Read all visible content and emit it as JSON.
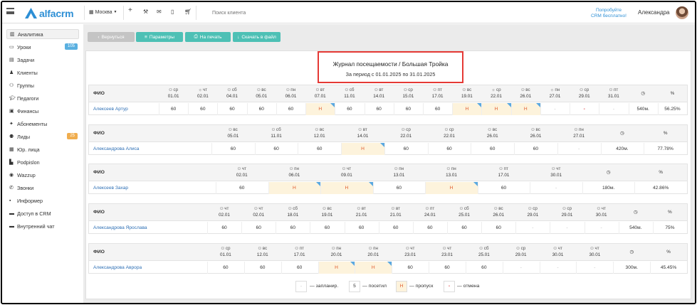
{
  "app": {
    "logo": "alfacrm",
    "city": "Москва",
    "search_placeholder": "Поиск клиента",
    "promo_line1": "Попробуйте",
    "promo_line2": "CRM бесплатно!",
    "user": "Александра",
    "accent": "#2d8fd5"
  },
  "toolbar_icons": [
    "plus-icon",
    "wrench-icon",
    "mail-icon",
    "phone-icon",
    "cart-icon"
  ],
  "sidebar": [
    {
      "label": "Аналитика",
      "icon": "chart-icon",
      "active": true
    },
    {
      "label": "Уроки",
      "icon": "calendar-icon",
      "badge": "105",
      "badge_color": "#5ab0e0"
    },
    {
      "label": "Задачи",
      "icon": "tasks-icon"
    },
    {
      "label": "Клиенты",
      "icon": "user-icon"
    },
    {
      "label": "Группы",
      "icon": "group-icon"
    },
    {
      "label": "Педагоги",
      "icon": "graduation-icon"
    },
    {
      "label": "Финансы",
      "icon": "money-icon"
    },
    {
      "label": "Абонементы",
      "icon": "ticket-icon"
    },
    {
      "label": "Лиды",
      "icon": "lead-icon",
      "badge": "25",
      "badge_color": "#f0ad4e"
    },
    {
      "label": "Юр. лица",
      "icon": "building-icon"
    },
    {
      "label": "Podpislon",
      "icon": "document-icon"
    },
    {
      "label": "Wazzup",
      "icon": "whatsapp-icon"
    },
    {
      "label": "Звонки",
      "icon": "phone-icon"
    },
    {
      "label": "Информер",
      "icon": "informer-icon"
    },
    {
      "label": "Доступ в CRM",
      "icon": "lock-icon"
    },
    {
      "label": "Внутренний чат",
      "icon": "chat-icon"
    }
  ],
  "buttons": [
    {
      "label": "Вернуться",
      "icon": "‹",
      "color": "#c4c4c4"
    },
    {
      "label": "Параметры",
      "icon": "≡",
      "color": "#4dc0b5"
    },
    {
      "label": "На печать",
      "icon": "⎙",
      "color": "#4dc0b5"
    },
    {
      "label": "Скачать в файл",
      "icon": "↓",
      "color": "#4dc0b5"
    }
  ],
  "report": {
    "title": "Журнал посещаемости / Большая Тройка",
    "period": "За период с 01.01.2025 по 31.01.2025",
    "fio_label": "ФИО"
  },
  "tables": [
    {
      "student": "Алексеев Артур",
      "cols": [
        [
          "group",
          "ср",
          "01.01"
        ],
        [
          "sun",
          "чт",
          "02.01"
        ],
        [
          "group",
          "сб",
          "04.01"
        ],
        [
          "group",
          "вс",
          "05.01"
        ],
        [
          "group",
          "пн",
          "06.01"
        ],
        [
          "group",
          "вт",
          "07.01"
        ],
        [
          "group",
          "сб",
          "11.01"
        ],
        [
          "group",
          "вт",
          "14.01"
        ],
        [
          "group",
          "ср",
          "15.01"
        ],
        [
          "group",
          "пт",
          "17.01"
        ],
        [
          "group",
          "вс",
          "19.01"
        ],
        [
          "sun",
          "ср",
          "22.01"
        ],
        [
          "group",
          "вс",
          "26.01"
        ],
        [
          "sun",
          "пн",
          "27.01"
        ],
        [
          "group",
          "ср",
          "29.01"
        ],
        [
          "group",
          "пт",
          "31.01"
        ]
      ],
      "values": [
        [
          "60",
          ""
        ],
        [
          "60",
          ""
        ],
        [
          "60",
          ""
        ],
        [
          "60",
          ""
        ],
        [
          "60",
          ""
        ],
        [
          "Н",
          "miss"
        ],
        [
          "60",
          ""
        ],
        [
          "60",
          ""
        ],
        [
          "60",
          ""
        ],
        [
          "60",
          ""
        ],
        [
          "Н",
          "miss"
        ],
        [
          "Н",
          "miss"
        ],
        [
          "Н",
          "miss"
        ],
        [
          "-",
          "plan"
        ],
        [
          "-",
          "cancel"
        ],
        [
          "-",
          "plan"
        ]
      ],
      "total": "540м.",
      "pct": "56.25%"
    },
    {
      "student": "Александрова Алиса",
      "cols": [
        [
          "group",
          "вс",
          "05.01"
        ],
        [
          "group",
          "сб",
          "11.01"
        ],
        [
          "group",
          "вс",
          "12.01"
        ],
        [
          "group",
          "вт",
          "14.01"
        ],
        [
          "group",
          "ср",
          "22.01"
        ],
        [
          "group",
          "ср",
          "22.01"
        ],
        [
          "group",
          "вс",
          "26.01"
        ],
        [
          "group",
          "вс",
          "26.01"
        ],
        [
          "group",
          "пн",
          "27.01"
        ]
      ],
      "values": [
        [
          "60",
          ""
        ],
        [
          "60",
          ""
        ],
        [
          "60",
          ""
        ],
        [
          "Н",
          "miss"
        ],
        [
          "60",
          ""
        ],
        [
          "60",
          ""
        ],
        [
          "60",
          ""
        ],
        [
          "60",
          ""
        ],
        [
          "-",
          "plan"
        ]
      ],
      "total": "420м.",
      "pct": "77.78%"
    },
    {
      "student": "Алексеев Захар",
      "cols": [
        [
          "group",
          "чт",
          "02.01"
        ],
        [
          "group",
          "пн",
          "06.01"
        ],
        [
          "group",
          "чт",
          "09.01"
        ],
        [
          "group",
          "пн",
          "13.01"
        ],
        [
          "group",
          "пн",
          "13.01"
        ],
        [
          "group",
          "пт",
          "17.01"
        ],
        [
          "group",
          "чт",
          "30.01"
        ]
      ],
      "values": [
        [
          "60",
          ""
        ],
        [
          "Н",
          "miss"
        ],
        [
          "Н",
          "miss"
        ],
        [
          "60",
          ""
        ],
        [
          "Н",
          "miss"
        ],
        [
          "60",
          ""
        ],
        [
          "-",
          "plan"
        ]
      ],
      "total": "180м.",
      "pct": "42.86%"
    },
    {
      "student": "Александрова Ярослава",
      "cols": [
        [
          "group",
          "чт",
          "02.01"
        ],
        [
          "group",
          "чт",
          "02.01"
        ],
        [
          "group",
          "сб",
          "18.01"
        ],
        [
          "group",
          "вс",
          "19.01"
        ],
        [
          "group",
          "вт",
          "21.01"
        ],
        [
          "group",
          "вт",
          "21.01"
        ],
        [
          "group",
          "пт",
          "24.01"
        ],
        [
          "group",
          "сб",
          "25.01"
        ],
        [
          "group",
          "вс",
          "26.01"
        ],
        [
          "group",
          "ср",
          "29.01"
        ],
        [
          "group",
          "ср",
          "29.01"
        ],
        [
          "group",
          "чт",
          "30.01"
        ]
      ],
      "values": [
        [
          "60",
          ""
        ],
        [
          "60",
          ""
        ],
        [
          "60",
          ""
        ],
        [
          "60",
          ""
        ],
        [
          "60",
          ""
        ],
        [
          "60",
          ""
        ],
        [
          "60",
          ""
        ],
        [
          "60",
          ""
        ],
        [
          "60",
          ""
        ],
        [
          "-",
          "plan"
        ],
        [
          "-",
          "plan"
        ],
        [
          "-",
          "plan"
        ]
      ],
      "total": "540м.",
      "pct": "75%"
    },
    {
      "student": "Александрова Аврора",
      "cols": [
        [
          "group",
          "ср",
          "01.01"
        ],
        [
          "group",
          "вс",
          "12.01"
        ],
        [
          "group",
          "пт",
          "17.01"
        ],
        [
          "group",
          "пн",
          "20.01"
        ],
        [
          "group",
          "пн",
          "20.01"
        ],
        [
          "group",
          "чт",
          "23.01"
        ],
        [
          "group",
          "чт",
          "23.01"
        ],
        [
          "group",
          "сб",
          "25.01"
        ],
        [
          "group",
          "ср",
          "29.01"
        ],
        [
          "group",
          "чт",
          "30.01"
        ],
        [
          "group",
          "чт",
          "30.01"
        ]
      ],
      "values": [
        [
          "60",
          ""
        ],
        [
          "60",
          ""
        ],
        [
          "60",
          ""
        ],
        [
          "Н",
          "miss"
        ],
        [
          "Н",
          "miss"
        ],
        [
          "60",
          ""
        ],
        [
          "60",
          ""
        ],
        [
          "60",
          ""
        ],
        [
          "-",
          "plan"
        ],
        [
          "-",
          "plan"
        ],
        [
          "-",
          "plan"
        ]
      ],
      "total": "300м.",
      "pct": "45.45%"
    }
  ],
  "legend": [
    {
      "mark": "-",
      "text": "— запланир.",
      "kind": "plan"
    },
    {
      "mark": "5",
      "text": "— посетил",
      "kind": ""
    },
    {
      "mark": "Н",
      "text": "— пропуск",
      "kind": "miss"
    },
    {
      "mark": "-",
      "text": "— отмена",
      "kind": "cancel"
    }
  ]
}
